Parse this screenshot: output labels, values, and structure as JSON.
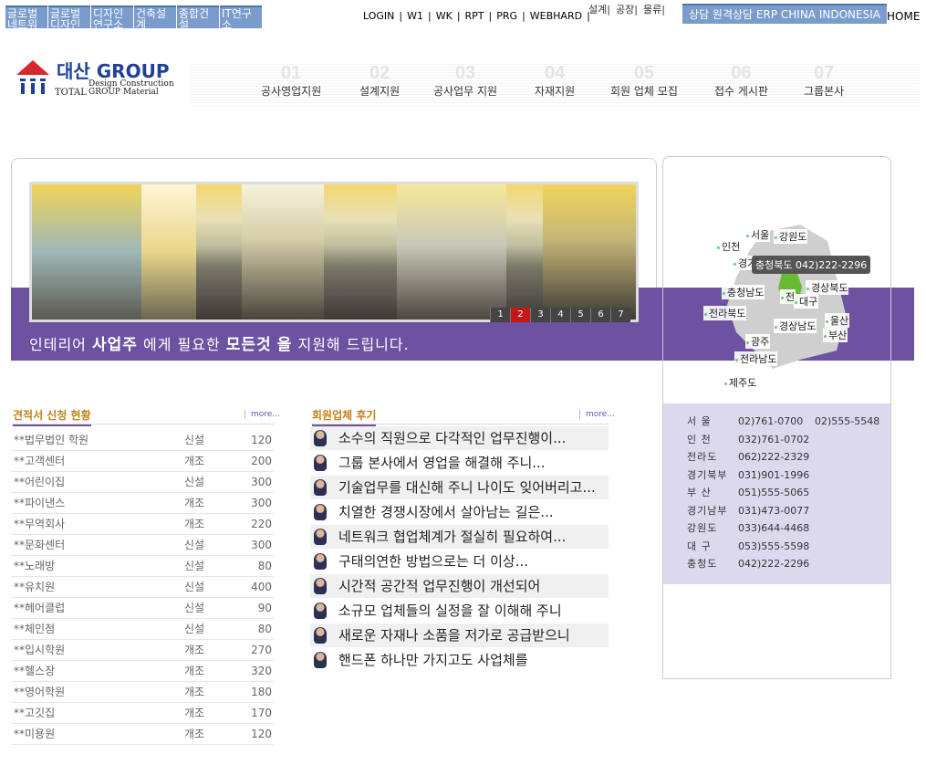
{
  "topbar": {
    "sites": [
      "글로벌네트워크",
      "글로벌디자인그룹",
      "디자인연구소",
      "건축설계",
      "종합건설",
      "IT연구소"
    ],
    "links": [
      "LOGIN",
      "W1",
      "WK",
      "RPT",
      "PRG",
      "WEBHARD"
    ],
    "vlinks": [
      "설계|",
      "공장|",
      "물류|"
    ],
    "right_box": "상담 원격상담 ERP CHINA INDONESIA",
    "home": "HOME"
  },
  "logo": {
    "brand": "대산 GROUP",
    "total": "TOTAL",
    "tagline": "Design Construction GROUP Material"
  },
  "nav": [
    {
      "num": "01",
      "label": "공사영업지원"
    },
    {
      "num": "02",
      "label": "설계지원"
    },
    {
      "num": "03",
      "label": "공사업무 지원"
    },
    {
      "num": "04",
      "label": "자재지원"
    },
    {
      "num": "05",
      "label": "회원 업체 모집"
    },
    {
      "num": "06",
      "label": "접수 게시판"
    },
    {
      "num": "07",
      "label": "그룹본사"
    }
  ],
  "banner": {
    "pages": [
      "1",
      "2",
      "3",
      "4",
      "5",
      "6",
      "7"
    ],
    "active_page": "2",
    "slogan": {
      "p1": "인테리어 ",
      "b1": "사업주",
      "p2": " 에게 필요한 ",
      "b2": "모든것",
      "p3": " ",
      "b3": "을",
      "p4": " 지원해 드립니다."
    }
  },
  "map": {
    "cities": [
      "서울",
      "강원도",
      "인천",
      "경기",
      "충청북도",
      "경상북도",
      "충청남도",
      "대구",
      "전라북도",
      "울산",
      "경상남도",
      "부산",
      "광주",
      "전라남도",
      "제주도",
      "전"
    ],
    "tooltip": "충청북도 042)222-2296",
    "contacts": [
      {
        "region": "서 울",
        "tel": "02)761-0700",
        "tel2": "02)555-5548"
      },
      {
        "region": "인 천",
        "tel": "032)761-0702",
        "tel2": ""
      },
      {
        "region": "전라도",
        "tel": "062)222-2329",
        "tel2": ""
      },
      {
        "region": "경기북부",
        "tel": "031)901-1996",
        "tel2": ""
      },
      {
        "region": "부 산",
        "tel": "051)555-5065",
        "tel2": ""
      },
      {
        "region": "경기남부",
        "tel": "031)473-0077",
        "tel2": ""
      },
      {
        "region": "강원도",
        "tel": "033)644-4468",
        "tel2": ""
      },
      {
        "region": "대 구",
        "tel": "053)555-5598",
        "tel2": ""
      },
      {
        "region": "충청도",
        "tel": "042)222-2296",
        "tel2": ""
      }
    ]
  },
  "estimates": {
    "title": "견적서 신청 현황",
    "more": "more...",
    "rows": [
      {
        "name": "**법무법인 학원",
        "kind": "신설",
        "area": "120"
      },
      {
        "name": "**고객센터",
        "kind": "개조",
        "area": "200"
      },
      {
        "name": "**어린이집",
        "kind": "신설",
        "area": "300"
      },
      {
        "name": "**파이낸스",
        "kind": "개조",
        "area": "300"
      },
      {
        "name": "**무역회사",
        "kind": "개조",
        "area": "220"
      },
      {
        "name": "**문화센터",
        "kind": "신설",
        "area": "300"
      },
      {
        "name": "**노래방",
        "kind": "신설",
        "area": "80"
      },
      {
        "name": "**유치원",
        "kind": "신설",
        "area": "400"
      },
      {
        "name": "**헤어클럽",
        "kind": "신설",
        "area": "90"
      },
      {
        "name": "**체인점",
        "kind": "신설",
        "area": "80"
      },
      {
        "name": "**입시학원",
        "kind": "개조",
        "area": "270"
      },
      {
        "name": "**헬스장",
        "kind": "개조",
        "area": "320"
      },
      {
        "name": "**영어학원",
        "kind": "개조",
        "area": "180"
      },
      {
        "name": "**고깃집",
        "kind": "개조",
        "area": "170"
      },
      {
        "name": "**미용원",
        "kind": "개조",
        "area": "120"
      }
    ]
  },
  "reviews": {
    "title": "회원업체 후기",
    "more": "more...",
    "items": [
      "소수의 직원으로 다각적인 업무진행이...",
      "그룹 본사에서 영업을 해결해 주니...",
      "기술업무를 대신해 주니 나이도 잊어버리고...",
      "치열한 경쟁시장에서 살아남는 길은...",
      "네트워크 협업체계가 절실히 필요하여...",
      "구태의연한 방법으로는 더 이상...",
      "시간적 공간적 업무진행이 개선되어",
      "소규모 업체들의 실정을 잘 이해해 주니",
      "새로운 자재나 소품을 저가로 공급받으니",
      "핸드폰 하나만 가지고도 사업체를"
    ]
  }
}
